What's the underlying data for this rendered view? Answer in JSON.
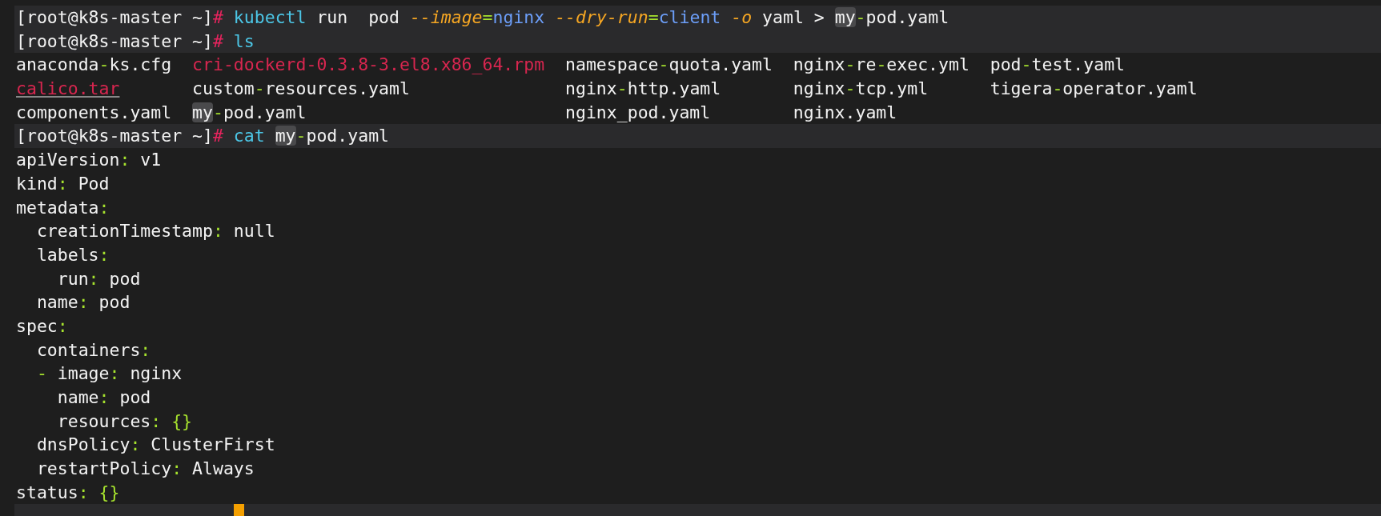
{
  "terminal": {
    "lines": [
      {
        "kind": "prompt",
        "highlighted": true,
        "tokens": [
          {
            "text": "[root@k8s-master ~]",
            "kind": "text"
          },
          {
            "text": "#",
            "kind": "sign"
          },
          {
            "text": " kubectl",
            "kind": "command"
          },
          {
            "text": " run  pod ",
            "kind": "text"
          },
          {
            "text": "--image",
            "kind": "option"
          },
          {
            "text": "=",
            "kind": "separator"
          },
          {
            "text": "nginx",
            "kind": "value"
          },
          {
            "text": " --dry-run",
            "kind": "option"
          },
          {
            "text": "=",
            "kind": "separator"
          },
          {
            "text": "client",
            "kind": "value"
          },
          {
            "text": " -o",
            "kind": "option"
          },
          {
            "text": " yaml > ",
            "kind": "text"
          },
          {
            "text": "my",
            "kind": "match"
          },
          {
            "text": "-",
            "kind": "separator"
          },
          {
            "text": "pod.yaml",
            "kind": "text"
          }
        ]
      },
      {
        "kind": "prompt",
        "highlighted": true,
        "tokens": [
          {
            "text": "[root@k8s-master ~]",
            "kind": "text"
          },
          {
            "text": "#",
            "kind": "sign"
          },
          {
            "text": " ls",
            "kind": "command"
          }
        ]
      },
      {
        "kind": "files",
        "files": [
          {
            "tokens": [
              {
                "text": "anaconda",
                "kind": "text"
              },
              {
                "text": "-",
                "kind": "separator"
              },
              {
                "text": "ks.cfg",
                "kind": "text"
              }
            ]
          },
          {
            "tokens": [
              {
                "text": "cri-dockerd-0.3.8-3.el8.x86_64.rpm",
                "kind": "package"
              }
            ]
          },
          {
            "tokens": [
              {
                "text": "namespace",
                "kind": "text"
              },
              {
                "text": "-",
                "kind": "separator"
              },
              {
                "text": "quota.yaml",
                "kind": "text"
              }
            ]
          },
          {
            "tokens": [
              {
                "text": "nginx",
                "kind": "text"
              },
              {
                "text": "-",
                "kind": "separator"
              },
              {
                "text": "re",
                "kind": "text"
              },
              {
                "text": "-",
                "kind": "separator"
              },
              {
                "text": "exec.yml",
                "kind": "text"
              }
            ]
          },
          {
            "tokens": [
              {
                "text": "pod",
                "kind": "text"
              },
              {
                "text": "-",
                "kind": "separator"
              },
              {
                "text": "test.yaml",
                "kind": "text"
              }
            ]
          }
        ]
      },
      {
        "kind": "files",
        "files": [
          {
            "tokens": [
              {
                "text": "calico.tar",
                "kind": "archive"
              }
            ]
          },
          {
            "tokens": [
              {
                "text": "custom",
                "kind": "text"
              },
              {
                "text": "-",
                "kind": "separator"
              },
              {
                "text": "resources.yaml",
                "kind": "text"
              }
            ]
          },
          {
            "tokens": [
              {
                "text": "nginx",
                "kind": "text"
              },
              {
                "text": "-",
                "kind": "separator"
              },
              {
                "text": "http.yaml",
                "kind": "text"
              }
            ]
          },
          {
            "tokens": [
              {
                "text": "nginx",
                "kind": "text"
              },
              {
                "text": "-",
                "kind": "separator"
              },
              {
                "text": "tcp.yml",
                "kind": "text"
              }
            ]
          },
          {
            "tokens": [
              {
                "text": "tigera",
                "kind": "text"
              },
              {
                "text": "-",
                "kind": "separator"
              },
              {
                "text": "operator.yaml",
                "kind": "text"
              }
            ]
          }
        ]
      },
      {
        "kind": "files",
        "files": [
          {
            "tokens": [
              {
                "text": "components.yaml",
                "kind": "text"
              }
            ]
          },
          {
            "tokens": [
              {
                "text": "my",
                "kind": "match"
              },
              {
                "text": "-",
                "kind": "separator"
              },
              {
                "text": "pod.yaml",
                "kind": "text"
              }
            ]
          },
          {
            "tokens": [
              {
                "text": "nginx_pod.yaml",
                "kind": "text"
              }
            ]
          },
          {
            "tokens": [
              {
                "text": "nginx.yaml",
                "kind": "text"
              }
            ]
          }
        ]
      },
      {
        "kind": "prompt",
        "highlighted": true,
        "tokens": [
          {
            "text": "[root@k8s-master ~]",
            "kind": "text"
          },
          {
            "text": "#",
            "kind": "sign"
          },
          {
            "text": " cat ",
            "kind": "command"
          },
          {
            "text": "my",
            "kind": "match"
          },
          {
            "text": "-",
            "kind": "separator"
          },
          {
            "text": "pod.yaml",
            "kind": "text"
          }
        ]
      },
      {
        "kind": "output",
        "tokens": [
          {
            "text": "apiVersion",
            "kind": "text"
          },
          {
            "text": ":",
            "kind": "separator"
          },
          {
            "text": " v1",
            "kind": "text"
          }
        ]
      },
      {
        "kind": "output",
        "tokens": [
          {
            "text": "kind",
            "kind": "text"
          },
          {
            "text": ":",
            "kind": "separator"
          },
          {
            "text": " Pod",
            "kind": "text"
          }
        ]
      },
      {
        "kind": "output",
        "tokens": [
          {
            "text": "metadata",
            "kind": "text"
          },
          {
            "text": ":",
            "kind": "separator"
          }
        ]
      },
      {
        "kind": "output",
        "tokens": [
          {
            "text": "  creationTimestamp",
            "kind": "text"
          },
          {
            "text": ":",
            "kind": "separator"
          },
          {
            "text": " null",
            "kind": "text"
          }
        ]
      },
      {
        "kind": "output",
        "tokens": [
          {
            "text": "  labels",
            "kind": "text"
          },
          {
            "text": ":",
            "kind": "separator"
          }
        ]
      },
      {
        "kind": "output",
        "tokens": [
          {
            "text": "    run",
            "kind": "text"
          },
          {
            "text": ":",
            "kind": "separator"
          },
          {
            "text": " pod",
            "kind": "text"
          }
        ]
      },
      {
        "kind": "output",
        "tokens": [
          {
            "text": "  name",
            "kind": "text"
          },
          {
            "text": ":",
            "kind": "separator"
          },
          {
            "text": " pod",
            "kind": "text"
          }
        ]
      },
      {
        "kind": "output",
        "tokens": [
          {
            "text": "spec",
            "kind": "text"
          },
          {
            "text": ":",
            "kind": "separator"
          }
        ]
      },
      {
        "kind": "output",
        "tokens": [
          {
            "text": "  containers",
            "kind": "text"
          },
          {
            "text": ":",
            "kind": "separator"
          }
        ]
      },
      {
        "kind": "output",
        "tokens": [
          {
            "text": "  -",
            "kind": "separator"
          },
          {
            "text": " image",
            "kind": "text"
          },
          {
            "text": ":",
            "kind": "separator"
          },
          {
            "text": " nginx",
            "kind": "text"
          }
        ]
      },
      {
        "kind": "output",
        "tokens": [
          {
            "text": "    name",
            "kind": "text"
          },
          {
            "text": ":",
            "kind": "separator"
          },
          {
            "text": " pod",
            "kind": "text"
          }
        ]
      },
      {
        "kind": "output",
        "tokens": [
          {
            "text": "    resources",
            "kind": "text"
          },
          {
            "text": ": {}",
            "kind": "separator"
          }
        ]
      },
      {
        "kind": "output",
        "tokens": [
          {
            "text": "  dnsPolicy",
            "kind": "text"
          },
          {
            "text": ":",
            "kind": "separator"
          },
          {
            "text": " ClusterFirst",
            "kind": "text"
          }
        ]
      },
      {
        "kind": "output",
        "tokens": [
          {
            "text": "  restartPolicy",
            "kind": "text"
          },
          {
            "text": ":",
            "kind": "separator"
          },
          {
            "text": " Always",
            "kind": "text"
          }
        ]
      },
      {
        "kind": "output",
        "tokens": [
          {
            "text": "status",
            "kind": "text"
          },
          {
            "text": ": {}",
            "kind": "separator"
          }
        ]
      },
      {
        "kind": "cursor-row",
        "highlighted": true,
        "cursor": true
      }
    ]
  }
}
